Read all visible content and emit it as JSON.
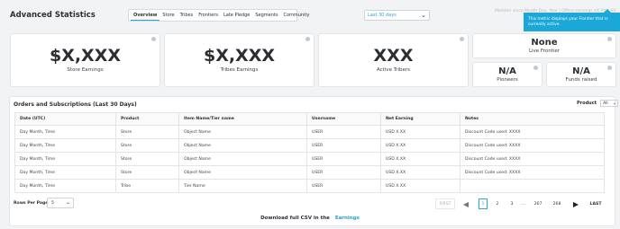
{
  "header": {
    "title": "Advanced Statistics",
    "tabs": [
      "Overview",
      "Store",
      "Tribes",
      "Frontiers",
      "Late Pledge",
      "Segments",
      "Community"
    ],
    "period": "Last 30 days",
    "faded_note": "Member since Month Day, Year | Offers earnings $X,XXX.XX"
  },
  "tooltip": {
    "text": "This metric displays your Frontier that is currently active."
  },
  "stats": {
    "store": {
      "value": "$X,XXX",
      "label": "Store Earnings"
    },
    "tribes": {
      "value": "$X,XXX",
      "label": "Tribes Earnings"
    },
    "active": {
      "value": "XXX",
      "label": "Active Tribers"
    },
    "frontier": {
      "value": "None",
      "label": "Live Frontier"
    },
    "pioneers": {
      "value": "N/A",
      "label": "Pioneers"
    },
    "funds": {
      "value": "N/A",
      "label": "Funds raised"
    }
  },
  "orders": {
    "title": "Orders and Subscriptions (Last 30 Days)",
    "product_filter_label": "Product",
    "product_filter_value": "All",
    "columns": [
      "Date (UTC)",
      "Product",
      "Item Name/Tier name",
      "Username",
      "Net Earning",
      "Notes"
    ],
    "rows": [
      [
        "Day Month, Time",
        "Store",
        "Object Name",
        "USER",
        "USD X.XX",
        "Discount Code used: XXXX"
      ],
      [
        "Day Month, Time",
        "Store",
        "Object Name",
        "USER",
        "USD X.XX",
        "Discount Code used: XXXX"
      ],
      [
        "Day Month, Time",
        "Store",
        "Object Name",
        "USER",
        "USD X.XX",
        "Discount Code used: XXXX"
      ],
      [
        "Day Month, Time",
        "Store",
        "Object Name",
        "USER",
        "USD X.XX",
        "Discount Code used: XXXX"
      ],
      [
        "Day Month, Time",
        "Tribe",
        "Tier Name",
        "USER",
        "USD X.XX",
        ""
      ]
    ]
  },
  "pagination": {
    "rows_per_page_label": "Rows Per Page",
    "rows_per_page_value": "5",
    "first": "FIRST",
    "pages": [
      "1",
      "2",
      "3",
      "...",
      "267",
      "268"
    ],
    "last": "LAST"
  },
  "footer": {
    "csv_text": "Download full CSV in the",
    "csv_link": "Earnings"
  },
  "colors": {
    "accent": "#1ba8d8",
    "link": "#1fa3d6"
  },
  "icons": {
    "info": "info-icon",
    "prev": "chevron-left-icon",
    "next": "chevron-right-icon",
    "dropdown": "chevron-down-icon"
  }
}
